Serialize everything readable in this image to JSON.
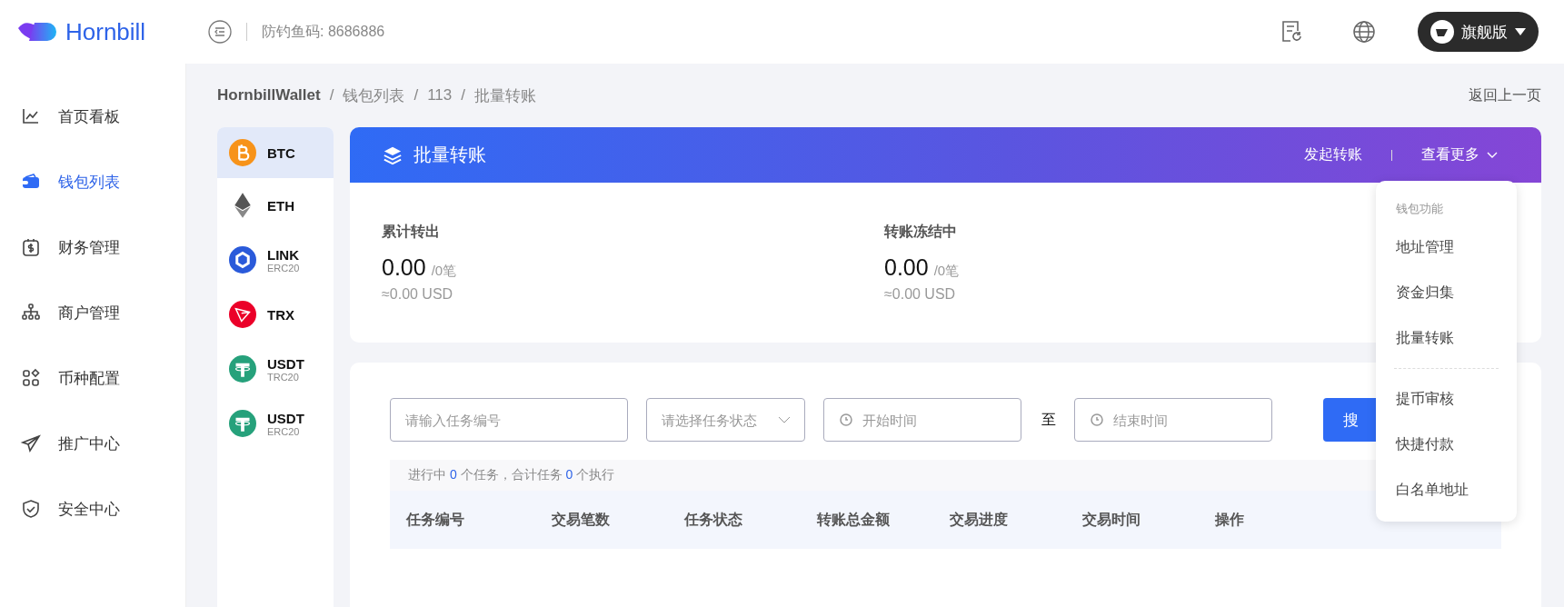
{
  "brand": {
    "name": "Hornbill"
  },
  "topbar": {
    "anti_phishing": "防钓鱼码: 8686886",
    "plan": "旗舰版"
  },
  "sidebar": {
    "items": [
      {
        "label": "首页看板",
        "kind": "chart",
        "selected": false
      },
      {
        "label": "钱包列表",
        "kind": "wallet",
        "selected": true
      },
      {
        "label": "财务管理",
        "kind": "finance",
        "selected": false
      },
      {
        "label": "商户管理",
        "kind": "org",
        "selected": false
      },
      {
        "label": "币种配置",
        "kind": "grid",
        "selected": false
      },
      {
        "label": "推广中心",
        "kind": "send",
        "selected": false
      },
      {
        "label": "安全中心",
        "kind": "shield",
        "selected": false
      }
    ]
  },
  "breadcrumb": {
    "separator": "/",
    "items": [
      "HornbillWallet",
      "钱包列表",
      "113",
      "批量转账"
    ]
  },
  "back_link": "返回上一页",
  "coins": [
    {
      "symbol": "BTC",
      "kind": "btc",
      "selected": true
    },
    {
      "symbol": "ETH",
      "kind": "eth",
      "selected": false
    },
    {
      "symbol": "LINK",
      "network": "ERC20",
      "kind": "link",
      "selected": false
    },
    {
      "symbol": "TRX",
      "kind": "trx",
      "selected": false
    },
    {
      "symbol": "USDT",
      "network": "TRC20",
      "kind": "usdt",
      "selected": false
    },
    {
      "symbol": "USDT",
      "network": "ERC20",
      "kind": "usdt",
      "selected": false
    }
  ],
  "banner": {
    "title": "批量转账",
    "actions": [
      "发起转账",
      "查看更多"
    ]
  },
  "stats": [
    {
      "label": "累计转出",
      "value": "0.00",
      "count": "/0笔",
      "usd": "≈0.00 USD"
    },
    {
      "label": "转账冻结中",
      "value": "0.00",
      "count": "/0笔",
      "usd": "≈0.00 USD"
    }
  ],
  "filters": {
    "task_id": {
      "placeholder": "请输入任务编号"
    },
    "status": {
      "placeholder": "请选择任务状态"
    },
    "start": {
      "placeholder": "开始时间"
    },
    "to": "至",
    "end": {
      "placeholder": "结束时间"
    },
    "search_button": "搜"
  },
  "summary": [
    "进行中 ",
    "0",
    " 个任务，合计任务 ",
    "0",
    " 个执行"
  ],
  "table": {
    "columns": [
      "任务编号",
      "交易笔数",
      "任务状态",
      "转账总金额",
      "交易进度",
      "交易时间",
      "操作"
    ]
  },
  "menu": {
    "header": "钱包功能",
    "groups": [
      [
        "地址管理",
        "资金归集",
        "批量转账"
      ],
      [
        "提币审核",
        "快捷付款",
        "白名单地址"
      ]
    ]
  }
}
